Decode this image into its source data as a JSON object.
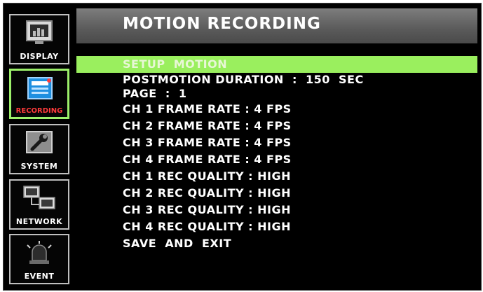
{
  "sidebar": {
    "items": [
      {
        "label": "DISPLAY",
        "icon": "display-icon",
        "active": false
      },
      {
        "label": "RECORDING",
        "icon": "recording-icon",
        "active": true
      },
      {
        "label": "SYSTEM",
        "icon": "system-icon",
        "active": false
      },
      {
        "label": "NETWORK",
        "icon": "network-icon",
        "active": false
      },
      {
        "label": "EVENT",
        "icon": "event-icon",
        "active": false
      }
    ]
  },
  "header": {
    "title": "MOTION RECORDING"
  },
  "menu": {
    "items": [
      {
        "label": "SETUP  MOTION",
        "selected": true
      },
      {
        "label": "POSTMOTION DURATION  :  150  SEC"
      },
      {
        "label": "PAGE  :  1"
      },
      {
        "label": "CH 1 FRAME RATE : 4 FPS"
      },
      {
        "label": "CH 2 FRAME RATE : 4 FPS"
      },
      {
        "label": "CH 3 FRAME RATE : 4 FPS"
      },
      {
        "label": "CH 4 FRAME RATE : 4 FPS"
      },
      {
        "label": "CH 1 REC QUALITY : HIGH"
      },
      {
        "label": "CH 2 REC QUALITY : HIGH"
      },
      {
        "label": "CH 3 REC QUALITY : HIGH"
      },
      {
        "label": "CH 4 REC QUALITY : HIGH"
      },
      {
        "label": "SAVE  AND  EXIT"
      }
    ]
  },
  "colors": {
    "selection": "#9aef5e",
    "active_border": "#9cf06a",
    "active_label": "#ff3b3b",
    "header": "#6a6a6a"
  }
}
